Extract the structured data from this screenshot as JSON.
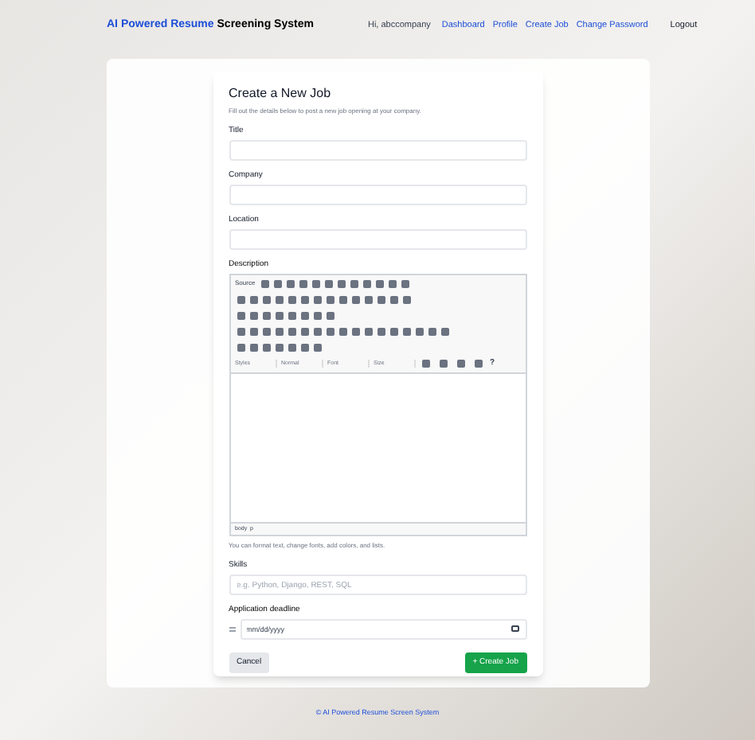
{
  "brand": {
    "highlight": "AI Powered Resume",
    "rest": "Screening System"
  },
  "nav": {
    "greeting": "Hi, abccompany",
    "links": [
      {
        "label": "Dashboard"
      },
      {
        "label": "Profile"
      },
      {
        "label": "Create Job"
      },
      {
        "label": "Change Password"
      }
    ],
    "logout": "Logout"
  },
  "form": {
    "title": "Create a New Job",
    "subtitle": "Fill out the details below to post a new job opening at your company.",
    "fields": [
      {
        "label": "Title"
      },
      {
        "label": "Company"
      },
      {
        "label": "Location"
      }
    ],
    "description": {
      "label": "Description",
      "source": "Source",
      "dropdowns": [
        "Styles",
        "Normal",
        "Font",
        "Size"
      ],
      "help": "?",
      "path": "body  p",
      "hint": "You can format text, change fonts, add colors, and lists."
    },
    "skills": {
      "label": "Skills",
      "placeholder": "e.g. Python, Django, REST, SQL"
    },
    "deadline": {
      "label": "Application deadline",
      "placeholder": "mm/dd/yyyy"
    },
    "cancel": "Cancel",
    "submit": "+ Create Job"
  },
  "footer": "© AI Powered Resume Screen System"
}
